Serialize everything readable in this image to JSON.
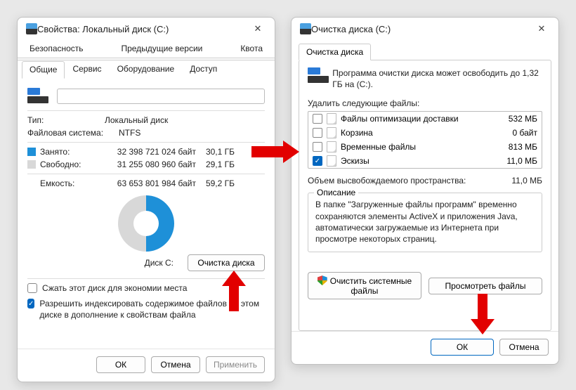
{
  "left": {
    "title": "Свойства: Локальный диск (C:)",
    "tabs_top": [
      "Безопасность",
      "Предыдущие версии",
      "Квота"
    ],
    "tabs_bottom": [
      "Общие",
      "Сервис",
      "Оборудование",
      "Доступ"
    ],
    "active_tab": "Общие",
    "name_value": "",
    "type_label": "Тип:",
    "type_value": "Локальный диск",
    "fs_label": "Файловая система:",
    "fs_value": "NTFS",
    "used_label": "Занято:",
    "used_bytes": "32 398 721 024 байт",
    "used_h": "30,1 ГБ",
    "free_label": "Свободно:",
    "free_bytes": "31 255 080 960 байт",
    "free_h": "29,1 ГБ",
    "cap_label": "Емкость:",
    "cap_bytes": "63 653 801 984 байт",
    "cap_h": "59,2 ГБ",
    "disk_label": "Диск C:",
    "cleanup_btn": "Очистка диска",
    "compress_label": "Сжать этот диск для экономии места",
    "index_label": "Разрешить индексировать содержимое файлов на этом диске в дополнение к свойствам файла",
    "ok": "ОК",
    "cancel": "Отмена",
    "apply": "Применить"
  },
  "right": {
    "title": "Очистка диска  (C:)",
    "tab": "Очистка диска",
    "intro": "Программа очистки диска может освободить до 1,32 ГБ на  (C:).",
    "delete_label": "Удалить следующие файлы:",
    "files": [
      {
        "name": "Файлы оптимизации доставки",
        "size": "532 МБ",
        "checked": false
      },
      {
        "name": "Корзина",
        "size": "0 байт",
        "checked": false
      },
      {
        "name": "Временные файлы",
        "size": "813 МБ",
        "checked": false
      },
      {
        "name": "Эскизы",
        "size": "11,0 МБ",
        "checked": true
      }
    ],
    "gain_label": "Объем высвобождаемого пространства:",
    "gain_value": "11,0 МБ",
    "desc_legend": "Описание",
    "desc_text": "В папке \"Загруженные файлы программ\" временно сохраняются элементы ActiveX и приложения Java, автоматически загружаемые из Интернета при просмотре некоторых страниц.",
    "sys_btn": "Очистить системные файлы",
    "view_btn": "Просмотреть файлы",
    "ok": "ОК",
    "cancel": "Отмена"
  },
  "colors": {
    "accent": "#0067c0",
    "used": "#1e90d8",
    "free": "#d8d8d8"
  }
}
